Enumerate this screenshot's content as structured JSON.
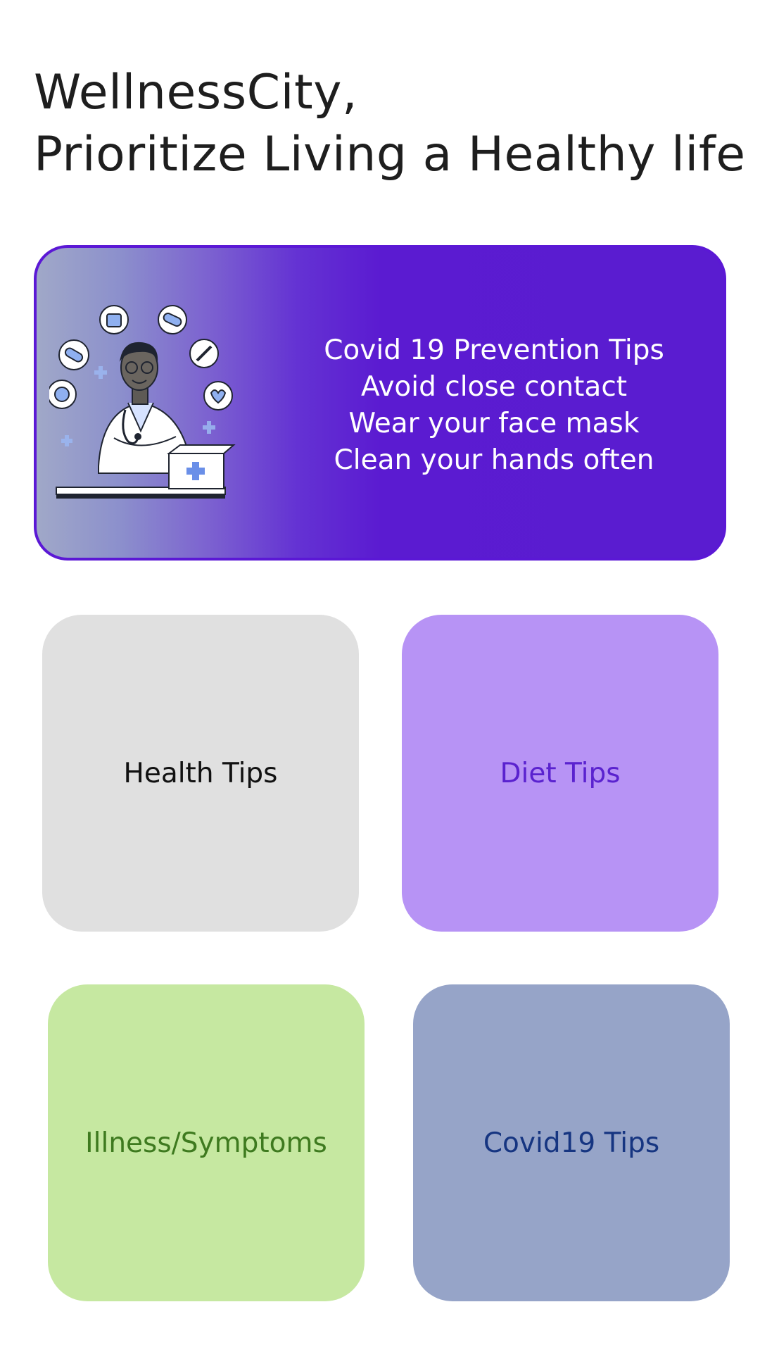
{
  "header": {
    "line1": "WellnessCity,",
    "line2": "Prioritize Living a Healthy life"
  },
  "banner": {
    "illustration_icon": "doctor-illustration",
    "tips": [
      "Covid 19 Prevention Tips",
      "Avoid close contact",
      "Wear your face mask",
      "Clean your hands often"
    ],
    "border_color": "#5b18d5",
    "background_color": "#5a1cd0"
  },
  "tiles": [
    {
      "label": "Health Tips",
      "bg": "#e0e0e0",
      "fg": "#111111"
    },
    {
      "label": "Diet Tips",
      "bg": "#b793f5",
      "fg": "#5a22cf"
    },
    {
      "label": "Illness/Symptoms",
      "bg": "#c6e8a1",
      "fg": "#3e7a1f"
    },
    {
      "label": "Covid19 Tips",
      "bg": "#96a4c8",
      "fg": "#163581"
    }
  ]
}
